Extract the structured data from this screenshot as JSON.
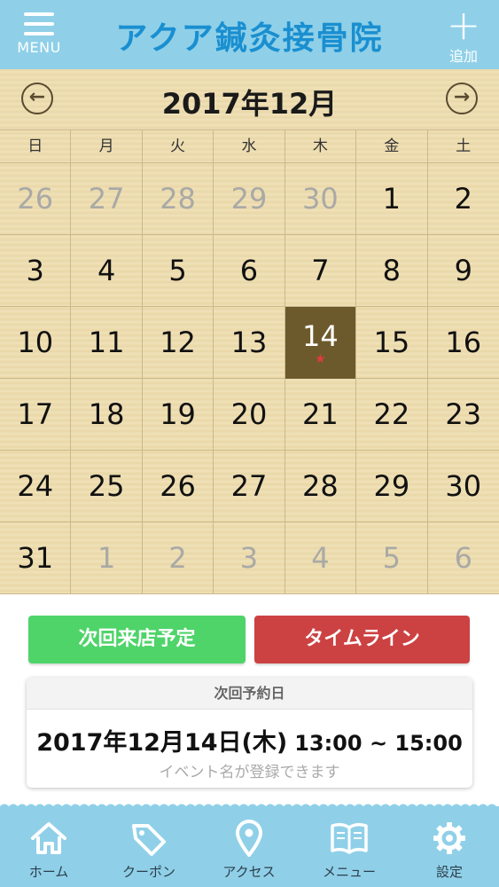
{
  "header": {
    "menu_label": "MENU",
    "title": "アクア鍼灸接骨院",
    "add_label": "追加"
  },
  "calendar": {
    "month_title": "2017年12月",
    "weekdays": [
      "日",
      "月",
      "火",
      "水",
      "木",
      "金",
      "土"
    ],
    "weeks": [
      [
        "26",
        "27",
        "28",
        "29",
        "30",
        "1",
        "2"
      ],
      [
        "3",
        "4",
        "5",
        "6",
        "7",
        "8",
        "9"
      ],
      [
        "10",
        "11",
        "12",
        "13",
        "14",
        "15",
        "16"
      ],
      [
        "17",
        "18",
        "19",
        "20",
        "21",
        "22",
        "23"
      ],
      [
        "24",
        "25",
        "26",
        "27",
        "28",
        "29",
        "30"
      ],
      [
        "31",
        "1",
        "2",
        "3",
        "4",
        "5",
        "6"
      ]
    ],
    "today_marker": "★"
  },
  "buttons": {
    "next_visit": "次回来店予定",
    "timeline": "タイムライン"
  },
  "appointment": {
    "heading": "次回予約日",
    "date": "2017年12月14日(木)",
    "time": "13:00 ~ 15:00",
    "event_placeholder": "イベント名が登録できます"
  },
  "tabbar": {
    "home": "ホーム",
    "coupon": "クーポン",
    "access": "アクセス",
    "menu": "メニュー",
    "settings": "設定"
  },
  "colors": {
    "header_bg": "#8fd0e8",
    "title": "#1a8fd0",
    "calendar_bg": "#eddcae",
    "today_bg": "#6d5a2c",
    "next_visit_btn": "#4fd46a",
    "timeline_btn": "#cc4242"
  }
}
